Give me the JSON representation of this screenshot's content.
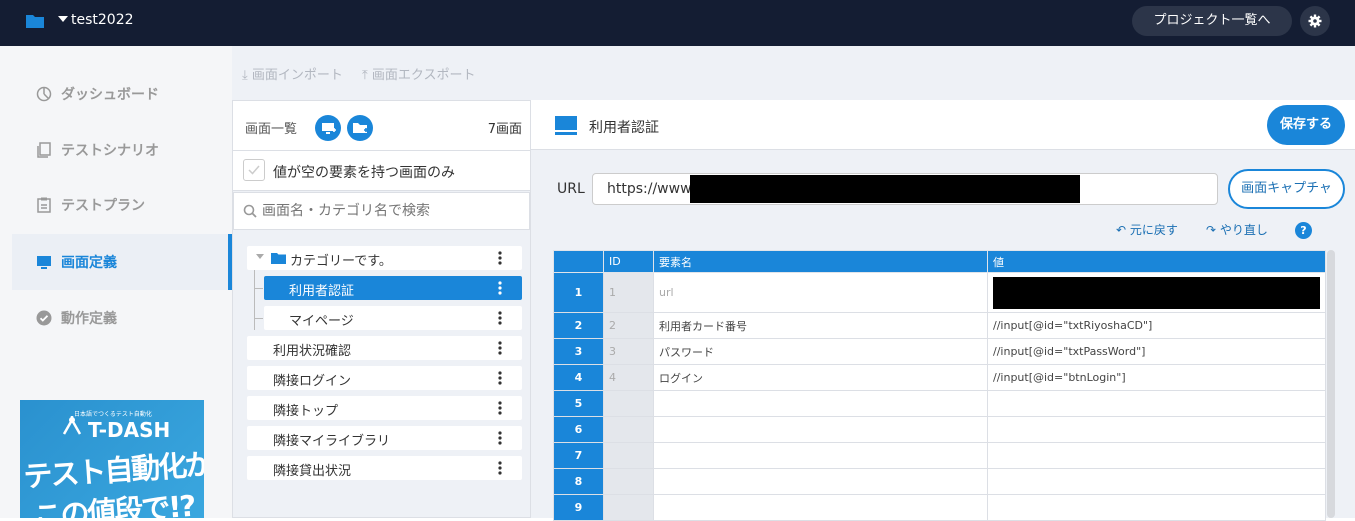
{
  "topbar": {
    "project_name": "test2022",
    "project_list_button": "プロジェクト一覧へ"
  },
  "nav": {
    "items": [
      {
        "label": "ダッシュボード",
        "icon": "pie-chart-icon",
        "active": false
      },
      {
        "label": "テストシナリオ",
        "icon": "documents-icon",
        "active": false
      },
      {
        "label": "テストプラン",
        "icon": "clipboard-icon",
        "active": false
      },
      {
        "label": "画面定義",
        "icon": "monitor-icon",
        "active": true
      },
      {
        "label": "動作定義",
        "icon": "check-circle-icon",
        "active": false
      }
    ],
    "banner": {
      "tagline": "日本語でつくるテスト自動化",
      "brand": "T-DASH",
      "headline_line1": "テスト自動化が",
      "headline_line2": "この値段で!?"
    }
  },
  "toolbar": {
    "import_label": "画面インポート",
    "export_label": "画面エクスポート"
  },
  "screen_list": {
    "title": "画面一覧",
    "count": "7画面",
    "filter_label": "値が空の要素を持つ画面のみ",
    "filter_checked": false,
    "search_placeholder": "画面名・カテゴリ名で検索",
    "category": "カテゴリーです。",
    "category_children": [
      "利用者認証",
      "マイページ"
    ],
    "selected": "利用者認証",
    "screens": [
      "利用状況確認",
      "隣接ログイン",
      "隣接トップ",
      "隣接マイライブラリ",
      "隣接貸出状況"
    ]
  },
  "editor": {
    "screen_title": "利用者認証",
    "save_button": "保存する",
    "url_label": "URL",
    "url_value": "https://www",
    "capture_button": "画面キャプチャ",
    "undo_label": "元に戻す",
    "redo_label": "やり直し",
    "help_label": "?",
    "table": {
      "headers": [
        "ID",
        "要素名",
        "値"
      ],
      "rows": [
        {
          "no": "1",
          "id": "1",
          "name": "url",
          "value": "",
          "value_redacted": true
        },
        {
          "no": "2",
          "id": "2",
          "name": "利用者カード番号",
          "value": "//input[@id=\"txtRiyoshaCD\"]"
        },
        {
          "no": "3",
          "id": "3",
          "name": "パスワード",
          "value": "//input[@id=\"txtPassWord\"]"
        },
        {
          "no": "4",
          "id": "4",
          "name": "ログイン",
          "value": "//input[@id=\"btnLogin\"]"
        },
        {
          "no": "5",
          "id": "",
          "name": "",
          "value": ""
        },
        {
          "no": "6",
          "id": "",
          "name": "",
          "value": ""
        },
        {
          "no": "7",
          "id": "",
          "name": "",
          "value": ""
        },
        {
          "no": "8",
          "id": "",
          "name": "",
          "value": ""
        },
        {
          "no": "9",
          "id": "",
          "name": "",
          "value": ""
        }
      ]
    }
  },
  "colors": {
    "accent": "#1a86d9",
    "topbar": "#141d33",
    "nav_bg": "#f5f6f8"
  }
}
